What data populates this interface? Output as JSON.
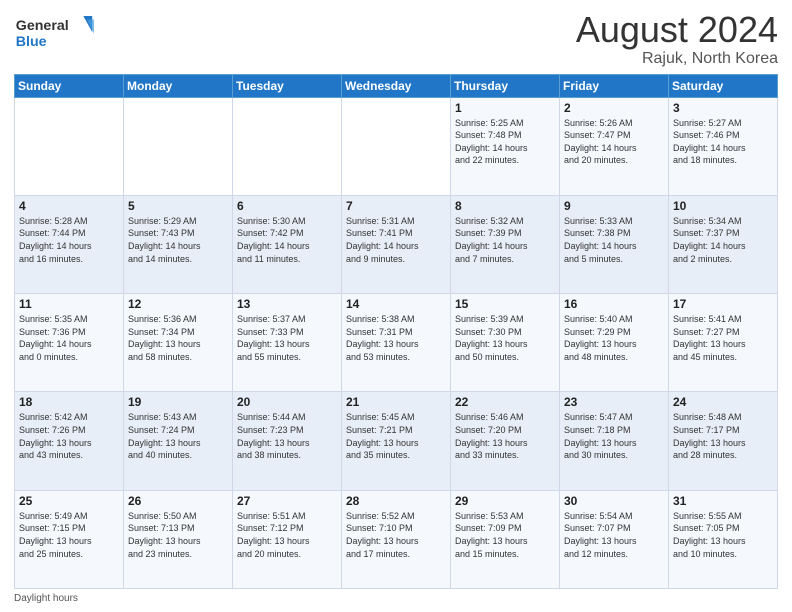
{
  "header": {
    "logo_line1": "General",
    "logo_line2": "Blue",
    "main_title": "August 2024",
    "sub_title": "Rajuk, North Korea"
  },
  "days_of_week": [
    "Sunday",
    "Monday",
    "Tuesday",
    "Wednesday",
    "Thursday",
    "Friday",
    "Saturday"
  ],
  "weeks": [
    [
      {
        "day": "",
        "info": ""
      },
      {
        "day": "",
        "info": ""
      },
      {
        "day": "",
        "info": ""
      },
      {
        "day": "",
        "info": ""
      },
      {
        "day": "1",
        "info": "Sunrise: 5:25 AM\nSunset: 7:48 PM\nDaylight: 14 hours\nand 22 minutes."
      },
      {
        "day": "2",
        "info": "Sunrise: 5:26 AM\nSunset: 7:47 PM\nDaylight: 14 hours\nand 20 minutes."
      },
      {
        "day": "3",
        "info": "Sunrise: 5:27 AM\nSunset: 7:46 PM\nDaylight: 14 hours\nand 18 minutes."
      }
    ],
    [
      {
        "day": "4",
        "info": "Sunrise: 5:28 AM\nSunset: 7:44 PM\nDaylight: 14 hours\nand 16 minutes."
      },
      {
        "day": "5",
        "info": "Sunrise: 5:29 AM\nSunset: 7:43 PM\nDaylight: 14 hours\nand 14 minutes."
      },
      {
        "day": "6",
        "info": "Sunrise: 5:30 AM\nSunset: 7:42 PM\nDaylight: 14 hours\nand 11 minutes."
      },
      {
        "day": "7",
        "info": "Sunrise: 5:31 AM\nSunset: 7:41 PM\nDaylight: 14 hours\nand 9 minutes."
      },
      {
        "day": "8",
        "info": "Sunrise: 5:32 AM\nSunset: 7:39 PM\nDaylight: 14 hours\nand 7 minutes."
      },
      {
        "day": "9",
        "info": "Sunrise: 5:33 AM\nSunset: 7:38 PM\nDaylight: 14 hours\nand 5 minutes."
      },
      {
        "day": "10",
        "info": "Sunrise: 5:34 AM\nSunset: 7:37 PM\nDaylight: 14 hours\nand 2 minutes."
      }
    ],
    [
      {
        "day": "11",
        "info": "Sunrise: 5:35 AM\nSunset: 7:36 PM\nDaylight: 14 hours\nand 0 minutes."
      },
      {
        "day": "12",
        "info": "Sunrise: 5:36 AM\nSunset: 7:34 PM\nDaylight: 13 hours\nand 58 minutes."
      },
      {
        "day": "13",
        "info": "Sunrise: 5:37 AM\nSunset: 7:33 PM\nDaylight: 13 hours\nand 55 minutes."
      },
      {
        "day": "14",
        "info": "Sunrise: 5:38 AM\nSunset: 7:31 PM\nDaylight: 13 hours\nand 53 minutes."
      },
      {
        "day": "15",
        "info": "Sunrise: 5:39 AM\nSunset: 7:30 PM\nDaylight: 13 hours\nand 50 minutes."
      },
      {
        "day": "16",
        "info": "Sunrise: 5:40 AM\nSunset: 7:29 PM\nDaylight: 13 hours\nand 48 minutes."
      },
      {
        "day": "17",
        "info": "Sunrise: 5:41 AM\nSunset: 7:27 PM\nDaylight: 13 hours\nand 45 minutes."
      }
    ],
    [
      {
        "day": "18",
        "info": "Sunrise: 5:42 AM\nSunset: 7:26 PM\nDaylight: 13 hours\nand 43 minutes."
      },
      {
        "day": "19",
        "info": "Sunrise: 5:43 AM\nSunset: 7:24 PM\nDaylight: 13 hours\nand 40 minutes."
      },
      {
        "day": "20",
        "info": "Sunrise: 5:44 AM\nSunset: 7:23 PM\nDaylight: 13 hours\nand 38 minutes."
      },
      {
        "day": "21",
        "info": "Sunrise: 5:45 AM\nSunset: 7:21 PM\nDaylight: 13 hours\nand 35 minutes."
      },
      {
        "day": "22",
        "info": "Sunrise: 5:46 AM\nSunset: 7:20 PM\nDaylight: 13 hours\nand 33 minutes."
      },
      {
        "day": "23",
        "info": "Sunrise: 5:47 AM\nSunset: 7:18 PM\nDaylight: 13 hours\nand 30 minutes."
      },
      {
        "day": "24",
        "info": "Sunrise: 5:48 AM\nSunset: 7:17 PM\nDaylight: 13 hours\nand 28 minutes."
      }
    ],
    [
      {
        "day": "25",
        "info": "Sunrise: 5:49 AM\nSunset: 7:15 PM\nDaylight: 13 hours\nand 25 minutes."
      },
      {
        "day": "26",
        "info": "Sunrise: 5:50 AM\nSunset: 7:13 PM\nDaylight: 13 hours\nand 23 minutes."
      },
      {
        "day": "27",
        "info": "Sunrise: 5:51 AM\nSunset: 7:12 PM\nDaylight: 13 hours\nand 20 minutes."
      },
      {
        "day": "28",
        "info": "Sunrise: 5:52 AM\nSunset: 7:10 PM\nDaylight: 13 hours\nand 17 minutes."
      },
      {
        "day": "29",
        "info": "Sunrise: 5:53 AM\nSunset: 7:09 PM\nDaylight: 13 hours\nand 15 minutes."
      },
      {
        "day": "30",
        "info": "Sunrise: 5:54 AM\nSunset: 7:07 PM\nDaylight: 13 hours\nand 12 minutes."
      },
      {
        "day": "31",
        "info": "Sunrise: 5:55 AM\nSunset: 7:05 PM\nDaylight: 13 hours\nand 10 minutes."
      }
    ]
  ],
  "footer": {
    "label": "Daylight hours"
  }
}
